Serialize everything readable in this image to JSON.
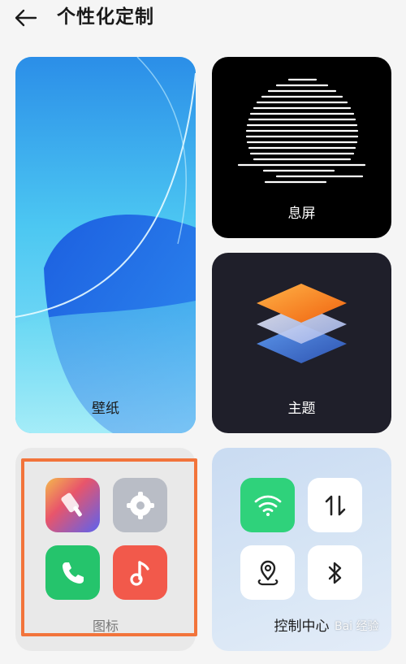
{
  "header": {
    "title": "个性化定制"
  },
  "cards": {
    "wallpaper": {
      "label": "壁纸"
    },
    "aod": {
      "label": "息屏"
    },
    "theme": {
      "label": "主题"
    },
    "icons": {
      "label": "图标"
    },
    "control_center": {
      "label": "控制中心"
    }
  },
  "watermark": {
    "text": "Bai 经验"
  },
  "colors": {
    "highlight": "#f2743b",
    "wifi_green": "#2fd27b",
    "phone_green": "#25c46c",
    "music_red": "#f2594b"
  },
  "icons": [
    "back-arrow-icon",
    "paintbrush-icon",
    "settings-gear-icon",
    "phone-icon",
    "music-note-icon",
    "wifi-icon",
    "data-transfer-icon",
    "location-icon",
    "bluetooth-icon"
  ]
}
